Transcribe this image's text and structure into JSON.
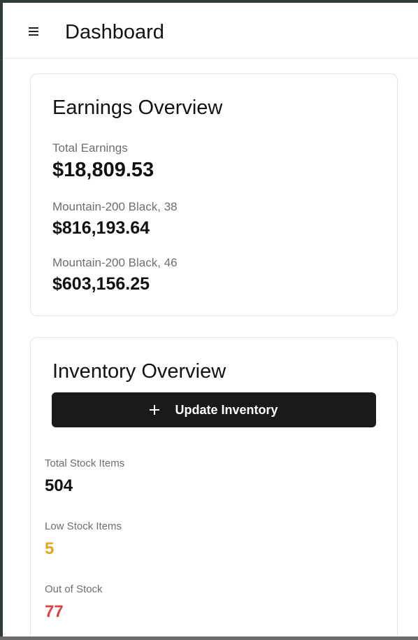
{
  "header": {
    "title": "Dashboard",
    "menu_icon": "hamburger-menu-icon"
  },
  "earnings": {
    "title": "Earnings Overview",
    "total_label": "Total Earnings",
    "total_value": "$18,809.53",
    "items": [
      {
        "label": "Mountain-200 Black, 38",
        "value": "$816,193.64"
      },
      {
        "label": "Mountain-200 Black, 46",
        "value": "$603,156.25"
      }
    ]
  },
  "inventory": {
    "title": "Inventory Overview",
    "update_button_label": "Update Inventory",
    "update_button_icon": "plus-icon",
    "stats": [
      {
        "label": "Total Stock Items",
        "value": "504",
        "color": "#111111"
      },
      {
        "label": "Low Stock Items",
        "value": "5",
        "color": "#e7a51c"
      },
      {
        "label": "Out of Stock",
        "value": "77",
        "color": "#e04141"
      }
    ]
  },
  "colors": {
    "primary_button": "#1a1a1a",
    "warning": "#e7a51c",
    "danger": "#e04141"
  }
}
